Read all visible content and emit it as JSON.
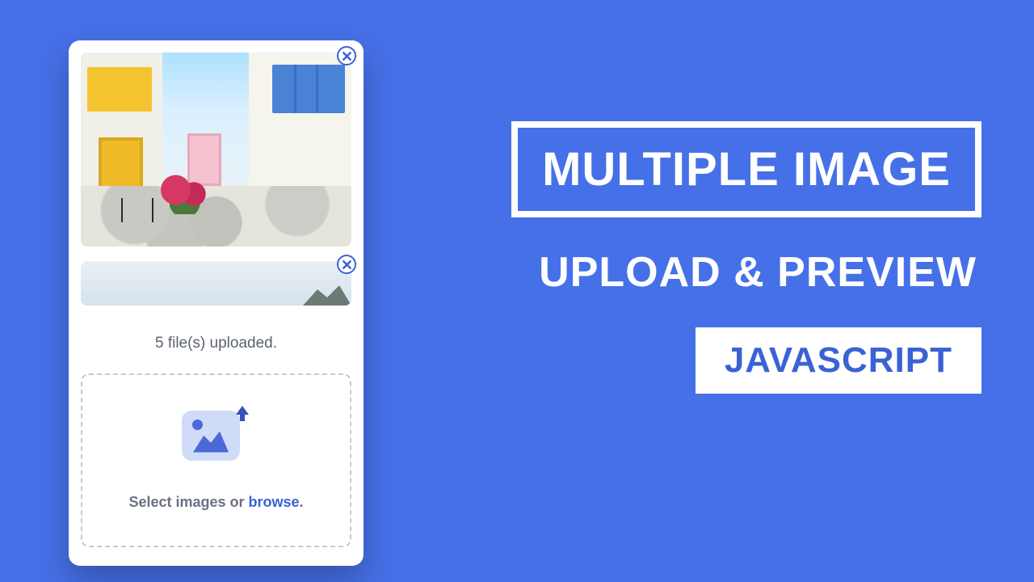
{
  "colors": {
    "background": "#4670e7",
    "accent": "#3a62d4",
    "text_muted": "#5a6270"
  },
  "card": {
    "previews": [
      {
        "close_label": "Remove image 1"
      },
      {
        "close_label": "Remove image 2"
      }
    ],
    "status_text": "5 file(s) uploaded.",
    "dropzone": {
      "prompt_prefix": "Select images or ",
      "browse_word": "browse",
      "prompt_suffix": ".",
      "icon_name": "image-upload-icon"
    }
  },
  "headline": {
    "boxed": "MULTIPLE IMAGE",
    "subtitle": "UPLOAD & PREVIEW",
    "badge": "JAVASCRIPT"
  }
}
